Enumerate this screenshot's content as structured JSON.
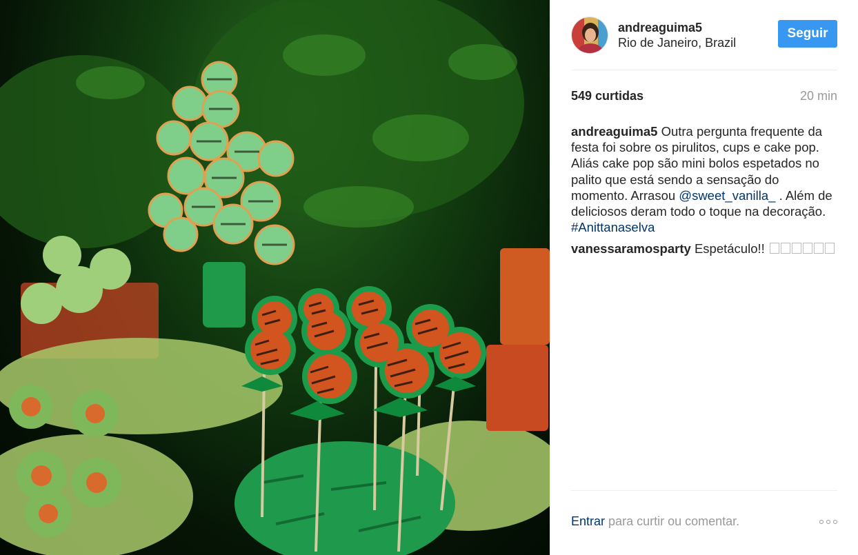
{
  "photo": {
    "icon": "post-photo"
  },
  "header": {
    "username": "andreaguima5",
    "location": "Rio de Janeiro, Brazil",
    "follow_label": "Seguir",
    "follow_color": "#3897f0"
  },
  "stats": {
    "likes": "549 curtidas",
    "time": "20 min"
  },
  "caption": {
    "username": "andreaguima5",
    "text_1": "Outra pergunta frequente da festa foi sobre os pirulitos, cups e cake pop. Aliás cake pop são mini bolos espetados no palito que está sendo a sensação do momento. Arrasou",
    "mention": "@sweet_vanilla_",
    "text_2": ". Além de deliciosos deram todo o toque na decoração.",
    "hashtag": "#Anittanaselva"
  },
  "comments": [
    {
      "username": "vanessaramosparty",
      "text": "Espetáculo!!",
      "emoji_count": 6
    }
  ],
  "footer": {
    "login_link": "Entrar",
    "prompt": "para curtir ou comentar."
  },
  "colors": {
    "link": "#003569",
    "muted": "#999999",
    "text": "#262626"
  }
}
